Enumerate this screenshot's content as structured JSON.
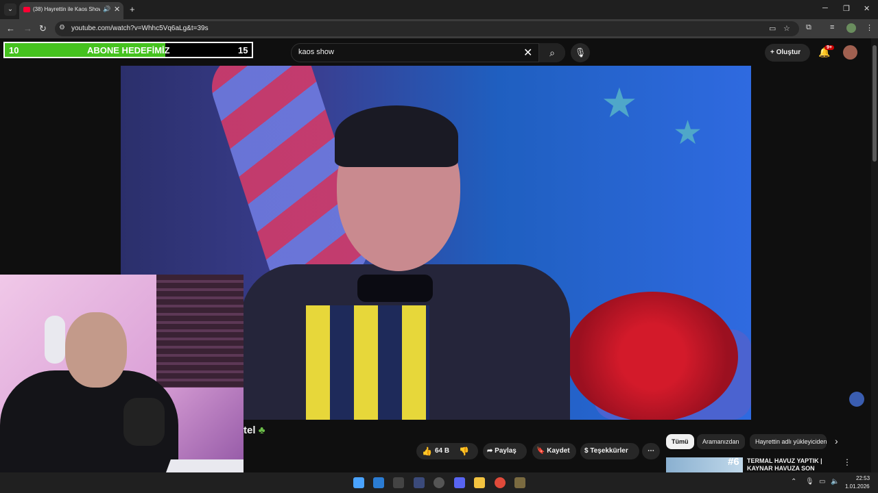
{
  "browser": {
    "tab_title": "(38) Hayrettin ile Kaos Show",
    "url": "youtube.com/watch?v=Whhc5Vq6aLg&t=39s"
  },
  "goal_overlay": {
    "left": "10",
    "title": "ABONE HEDEFİMİZ",
    "right": "15",
    "progress_percent": 65
  },
  "search": {
    "query": "kaos show"
  },
  "header": {
    "create_label": "Oluştur",
    "notifications_badge": "9+"
  },
  "video": {
    "title_fragment": "tel"
  },
  "actions": {
    "like_count": "64 B",
    "share_label": "Paylaş",
    "save_label": "Kaydet",
    "thanks_label": "Teşekkürler"
  },
  "chips": {
    "all": "Tümü",
    "from_search": "Aramanızdan",
    "uploader": "Hayrettin adlı yükleyiciden"
  },
  "recommendation": {
    "thumb_number": "#6",
    "title": "TERMAL HAVUZ YAPTIK | KAYNAR HAVUZA SON DÜŞEN"
  },
  "taskbar": {
    "time": "22:53",
    "date": "1.01.2026"
  }
}
